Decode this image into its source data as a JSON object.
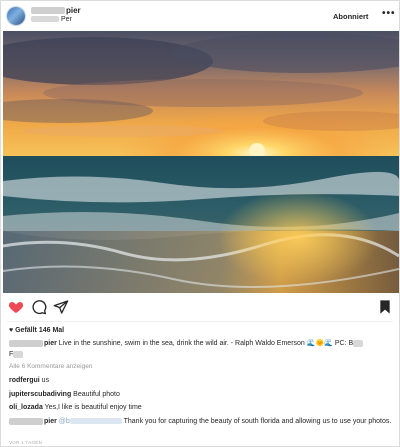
{
  "header": {
    "username_visible": "pier",
    "location": "Per",
    "follow_label": "Abonniert",
    "more_label": "•••"
  },
  "photo": {
    "description_icon": "sunset-beach-photo"
  },
  "actions": {
    "like_icon": "heart-filled-icon",
    "comment_icon": "comment-bubble-icon",
    "share_icon": "paper-plane-icon",
    "save_icon": "bookmark-icon",
    "like_color": "#ed4956"
  },
  "likes": "♥ Gefällt 146 Mal",
  "caption": {
    "user": "pier",
    "text": " Live in the sunshine, swim in the sea, drink the wild air. - Ralph Waldo Emerson ",
    "emoji": "🌊🌞🌊",
    "credit": " PC: B",
    "credit_line2": "F"
  },
  "view_all": "Alle 6 Kommentare anzeigen",
  "comments": [
    {
      "user": "rodfergui",
      "text": " us"
    },
    {
      "user": "jupiterscubadiving",
      "text": " Beautiful photo"
    },
    {
      "user": "oli_lozada",
      "text": " Yes,I like is  beautiful  enjoy time"
    }
  ],
  "last_comment": {
    "user": "pier",
    "mention": "@b",
    "text": " Thank you for capturing the beauty of south florida and allowing us to use your photos."
  },
  "timestamp": "VOR 1 TAGEN"
}
